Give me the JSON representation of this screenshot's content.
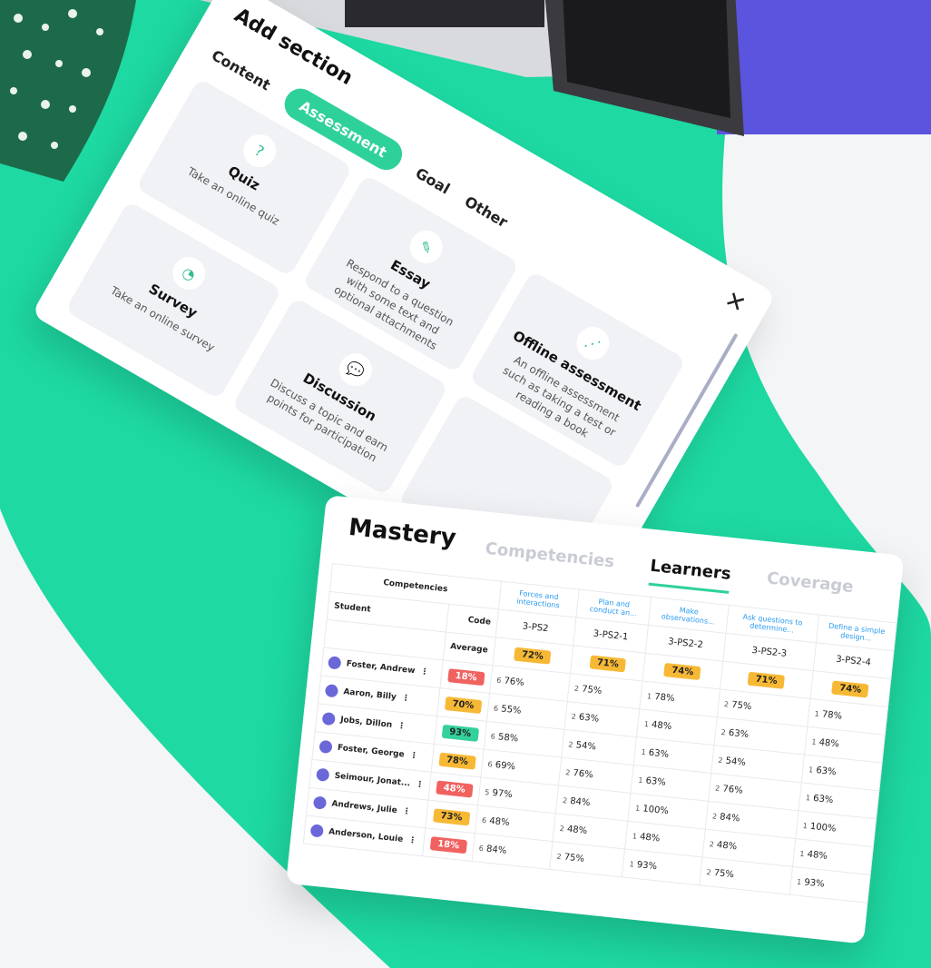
{
  "add_section": {
    "title": "Add section",
    "tabs": [
      "Content",
      "Assessment",
      "Goal",
      "Other"
    ],
    "active_tab": "Assessment",
    "tiles": [
      {
        "name": "Quiz",
        "desc": "Take an online quiz",
        "icon": "quiz-icon"
      },
      {
        "name": "Essay",
        "desc": "Respond to a question with some text and optional attachments",
        "icon": "pencil-icon"
      },
      {
        "name": "Offline assessment",
        "desc": "An offline assessment such as taking a test or reading a book",
        "icon": "wifi-off-icon"
      },
      {
        "name": "Survey",
        "desc": "Take an online survey",
        "icon": "pie-chart-icon"
      },
      {
        "name": "Discussion",
        "desc": "Discuss a topic and earn points for participation",
        "icon": "chat-icon"
      },
      {
        "name": "",
        "desc": "",
        "icon": ""
      }
    ]
  },
  "mastery": {
    "title": "Mastery",
    "tabs": [
      "Competencies",
      "Learners",
      "Coverage"
    ],
    "active_tab": "Learners",
    "header": {
      "competencies_label": "Competencies",
      "student_label": "Student",
      "code_label": "Code",
      "average_label": "Average"
    },
    "competencies": [
      {
        "title": "Forces and interactions",
        "code": "3-PS2",
        "avg": "72%"
      },
      {
        "title": "Plan and conduct an...",
        "code": "3-PS2-1",
        "avg": "71%"
      },
      {
        "title": "Make observations...",
        "code": "3-PS2-2",
        "avg": "74%"
      },
      {
        "title": "Ask questions to determine...",
        "code": "3-PS2-3",
        "avg": "71%"
      },
      {
        "title": "Define a simple design...",
        "code": "3-PS2-4",
        "avg": "74%"
      }
    ],
    "students": [
      {
        "name": "Foster, Andrew",
        "avg": "18%",
        "avg_color": "red",
        "cells": [
          [
            "6",
            "76%"
          ],
          [
            "2",
            "75%"
          ],
          [
            "1",
            "78%"
          ],
          [
            "2",
            "75%"
          ],
          [
            "1",
            "78%"
          ]
        ]
      },
      {
        "name": "Aaron, Billy",
        "avg": "70%",
        "avg_color": "yel",
        "cells": [
          [
            "6",
            "55%"
          ],
          [
            "2",
            "63%"
          ],
          [
            "1",
            "48%"
          ],
          [
            "2",
            "63%"
          ],
          [
            "1",
            "48%"
          ]
        ]
      },
      {
        "name": "Jobs, Dillon",
        "avg": "93%",
        "avg_color": "grn",
        "cells": [
          [
            "6",
            "58%"
          ],
          [
            "2",
            "54%"
          ],
          [
            "1",
            "63%"
          ],
          [
            "2",
            "54%"
          ],
          [
            "1",
            "63%"
          ]
        ]
      },
      {
        "name": "Foster, George",
        "avg": "78%",
        "avg_color": "yel",
        "cells": [
          [
            "6",
            "69%"
          ],
          [
            "2",
            "76%"
          ],
          [
            "1",
            "63%"
          ],
          [
            "2",
            "76%"
          ],
          [
            "1",
            "63%"
          ]
        ]
      },
      {
        "name": "Seimour, Jonat...",
        "avg": "48%",
        "avg_color": "red",
        "cells": [
          [
            "5",
            "97%"
          ],
          [
            "2",
            "84%"
          ],
          [
            "1",
            "100%"
          ],
          [
            "2",
            "84%"
          ],
          [
            "1",
            "100%"
          ]
        ]
      },
      {
        "name": "Andrews, Julie",
        "avg": "73%",
        "avg_color": "yel",
        "cells": [
          [
            "6",
            "48%"
          ],
          [
            "2",
            "48%"
          ],
          [
            "1",
            "48%"
          ],
          [
            "2",
            "48%"
          ],
          [
            "1",
            "48%"
          ]
        ]
      },
      {
        "name": "Anderson, Louie",
        "avg": "18%",
        "avg_color": "red",
        "cells": [
          [
            "6",
            "84%"
          ],
          [
            "2",
            "75%"
          ],
          [
            "1",
            "93%"
          ],
          [
            "2",
            "75%"
          ],
          [
            "1",
            "93%"
          ]
        ]
      }
    ]
  },
  "colors": {
    "green": "#2fd19a",
    "purple": "#5b54de",
    "red": "#f0625f",
    "yellow": "#f7b935"
  }
}
